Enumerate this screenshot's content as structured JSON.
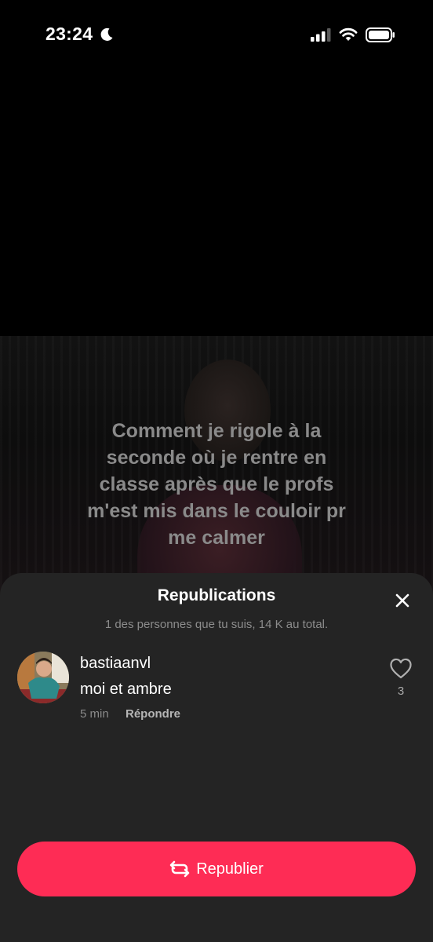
{
  "status_bar": {
    "time": "23:24",
    "focus_icon": "moon-icon",
    "signal_icon": "cellular-signal-icon",
    "wifi_icon": "wifi-icon",
    "battery_icon": "battery-icon"
  },
  "video": {
    "caption": "Comment je rigole à la\nseconde où je rentre en\nclasse après que le profs\nm'est mis dans le couloir pr\nme calmer"
  },
  "sheet": {
    "title": "Republications",
    "subtitle": "1 des personnes que tu suis, 14 K au total.",
    "close_icon": "close-icon",
    "comments": [
      {
        "username": "bastiaanvl",
        "text": "moi et ambre",
        "time": "5 min",
        "reply_label": "Répondre",
        "like_icon": "heart-icon",
        "like_count": "3"
      }
    ],
    "republish_label": "Republier",
    "republish_icon": "repost-icon"
  },
  "colors": {
    "accent": "#fe2c55",
    "sheet_background": "#242424",
    "background": "#000000"
  }
}
